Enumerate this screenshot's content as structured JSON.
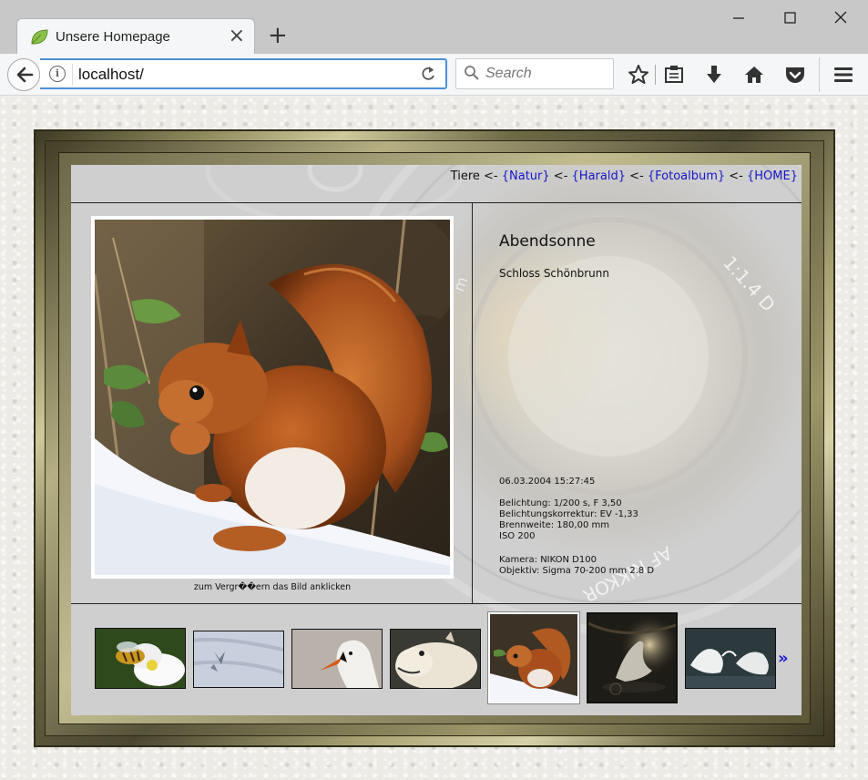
{
  "browser": {
    "tab_title": "Unsere Homepage",
    "url": "localhost/",
    "search_placeholder": "Search",
    "icons": [
      "back-icon",
      "info-icon",
      "reload-icon",
      "search-icon",
      "bookmark-star-icon",
      "reading-list-icon",
      "download-icon",
      "home-icon",
      "pocket-icon",
      "menu-icon"
    ]
  },
  "breadcrumb": {
    "current": "Tiere",
    "separator": " <- ",
    "links": [
      "{Natur}",
      "{Harald}",
      "{Fotoalbum}",
      "{HOME}"
    ]
  },
  "photo": {
    "title": "Abendsonne",
    "subtitle": "Schloss Schönbrunn",
    "caption": "zum Vergr��ern das Bild anklicken",
    "datetime": "06.03.2004 15:27:45",
    "exposure": "Belichtung: 1/200 s, F 3,50",
    "exposure_correction": "Belichtungskorrektur: EV -1,33",
    "focal_length": "Brennweite: 180,00 mm",
    "iso": "ISO 200",
    "camera": "Kamera: NIKON D100",
    "lens": "Objektiv: Sigma 70-200 mm 2.8 D"
  },
  "lens_text": {
    "ratio": "1:1.4 D",
    "brand": "AF NIKKOR",
    "partial": "m"
  },
  "thumbnails": {
    "count": 7,
    "active_index": 4,
    "subjects": [
      "bee-on-flower",
      "bird-shadow-on-snow",
      "swan-head",
      "llama",
      "squirrel",
      "swan-at-sunset",
      "swans-splashing"
    ],
    "next_label": "»"
  }
}
